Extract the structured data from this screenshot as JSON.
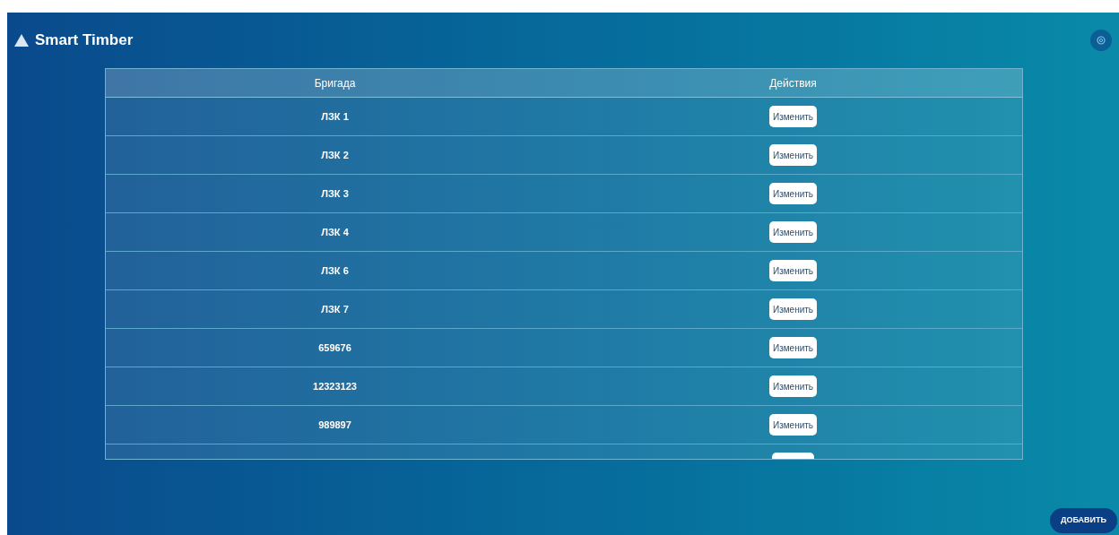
{
  "app": {
    "title": "Smart Timber"
  },
  "table": {
    "columns": [
      "Бригада",
      "Действия"
    ],
    "rows": [
      {
        "name": "ЛЗК 1",
        "action": "Изменить"
      },
      {
        "name": "ЛЗК 2",
        "action": "Изменить"
      },
      {
        "name": "ЛЗК 3",
        "action": "Изменить"
      },
      {
        "name": "ЛЗК 4",
        "action": "Изменить"
      },
      {
        "name": "ЛЗК 6",
        "action": "Изменить"
      },
      {
        "name": "ЛЗК 7",
        "action": "Изменить"
      },
      {
        "name": "659676",
        "action": "Изменить"
      },
      {
        "name": "12323123",
        "action": "Изменить"
      },
      {
        "name": "989897",
        "action": "Изменить"
      }
    ]
  },
  "add_button": "ДОБАВИТЬ"
}
